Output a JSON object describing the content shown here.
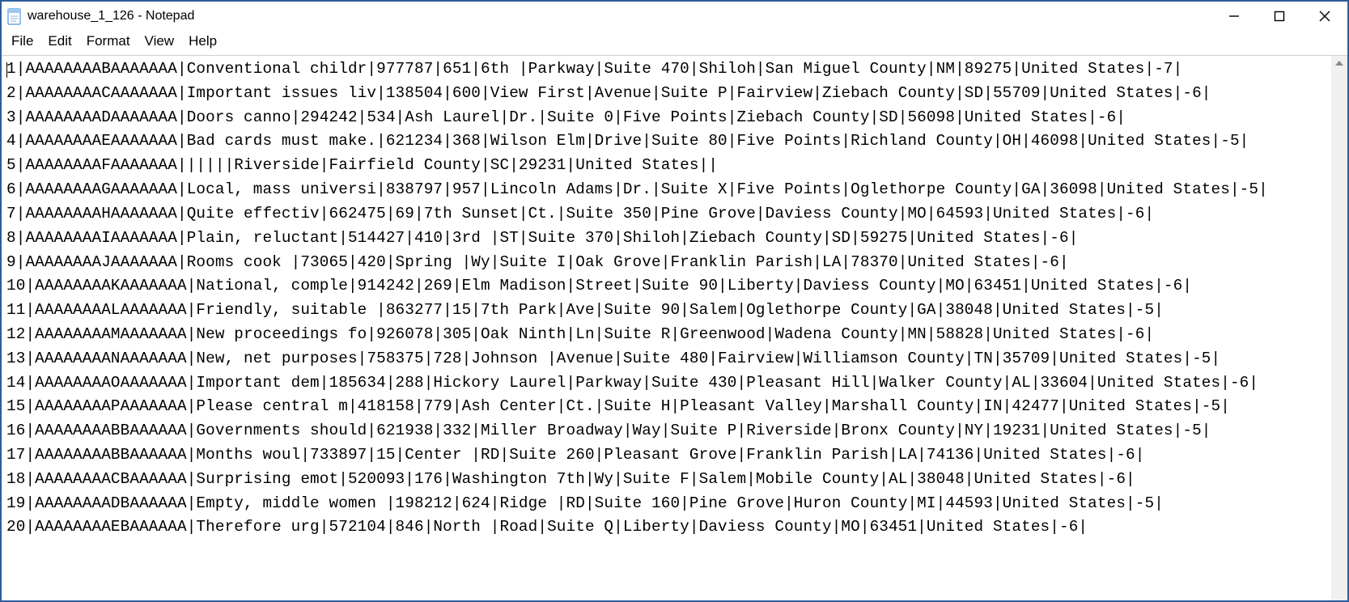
{
  "window": {
    "title": "warehouse_1_126 - Notepad"
  },
  "menu": {
    "file": "File",
    "edit": "Edit",
    "format": "Format",
    "view": "View",
    "help": "Help"
  },
  "lines": [
    "1|AAAAAAAABAAAAAAA|Conventional childr|977787|651|6th |Parkway|Suite 470|Shiloh|San Miguel County|NM|89275|United States|-7|",
    "2|AAAAAAAACAAAAAAA|Important issues liv|138504|600|View First|Avenue|Suite P|Fairview|Ziebach County|SD|55709|United States|-6|",
    "3|AAAAAAAADAAAAAAA|Doors canno|294242|534|Ash Laurel|Dr.|Suite 0|Five Points|Ziebach County|SD|56098|United States|-6|",
    "4|AAAAAAAAEAAAAAAA|Bad cards must make.|621234|368|Wilson Elm|Drive|Suite 80|Five Points|Richland County|OH|46098|United States|-5|",
    "5|AAAAAAAAFAAAAAAA||||||Riverside|Fairfield County|SC|29231|United States||",
    "6|AAAAAAAAGAAAAAAA|Local, mass universi|838797|957|Lincoln Adams|Dr.|Suite X|Five Points|Oglethorpe County|GA|36098|United States|-5|",
    "7|AAAAAAAAHAAAAAAA|Quite effectiv|662475|69|7th Sunset|Ct.|Suite 350|Pine Grove|Daviess County|MO|64593|United States|-6|",
    "8|AAAAAAAAIAAAAAAA|Plain, reluctant|514427|410|3rd |ST|Suite 370|Shiloh|Ziebach County|SD|59275|United States|-6|",
    "9|AAAAAAAAJAAAAAAA|Rooms cook |73065|420|Spring |Wy|Suite I|Oak Grove|Franklin Parish|LA|78370|United States|-6|",
    "10|AAAAAAAAKAAAAAAA|National, comple|914242|269|Elm Madison|Street|Suite 90|Liberty|Daviess County|MO|63451|United States|-6|",
    "11|AAAAAAAALAAAAAAA|Friendly, suitable |863277|15|7th Park|Ave|Suite 90|Salem|Oglethorpe County|GA|38048|United States|-5|",
    "12|AAAAAAAAMAAAAAAA|New proceedings fo|926078|305|Oak Ninth|Ln|Suite R|Greenwood|Wadena County|MN|58828|United States|-6|",
    "13|AAAAAAAANAAAAAAA|New, net purposes|758375|728|Johnson |Avenue|Suite 480|Fairview|Williamson County|TN|35709|United States|-5|",
    "14|AAAAAAAAOAAAAAAA|Important dem|185634|288|Hickory Laurel|Parkway|Suite 430|Pleasant Hill|Walker County|AL|33604|United States|-6|",
    "15|AAAAAAAAPAAAAAAA|Please central m|418158|779|Ash Center|Ct.|Suite H|Pleasant Valley|Marshall County|IN|42477|United States|-5|",
    "16|AAAAAAAABBAAAAAA|Governments should|621938|332|Miller Broadway|Way|Suite P|Riverside|Bronx County|NY|19231|United States|-5|",
    "17|AAAAAAAABBAAAAAA|Months woul|733897|15|Center |RD|Suite 260|Pleasant Grove|Franklin Parish|LA|74136|United States|-6|",
    "18|AAAAAAAACBAAAAAA|Surprising emot|520093|176|Washington 7th|Wy|Suite F|Salem|Mobile County|AL|38048|United States|-6|",
    "19|AAAAAAAADBAAAAAA|Empty, middle women |198212|624|Ridge |RD|Suite 160|Pine Grove|Huron County|MI|44593|United States|-5|",
    "20|AAAAAAAAEBAAAAAA|Therefore urg|572104|846|North |Road|Suite Q|Liberty|Daviess County|MO|63451|United States|-6|"
  ]
}
